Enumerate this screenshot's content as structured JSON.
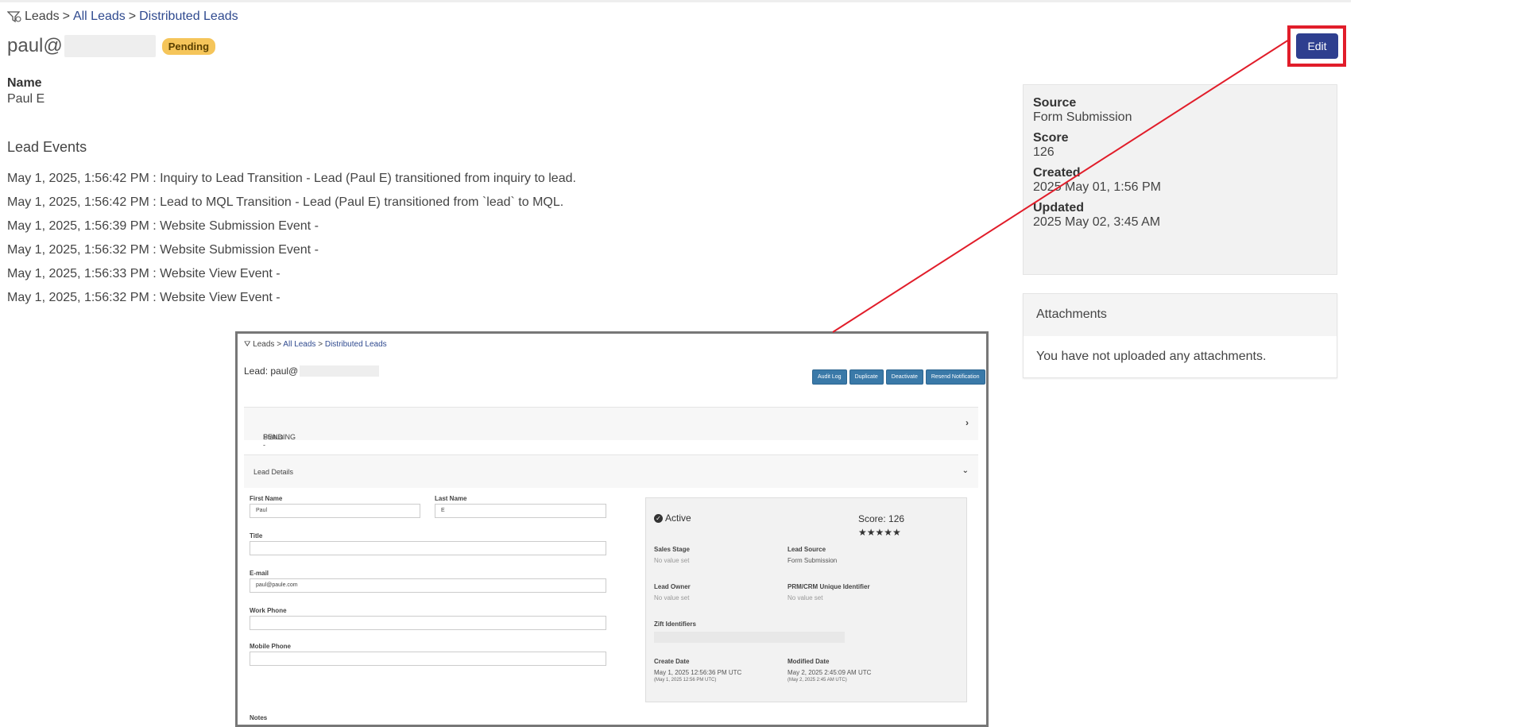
{
  "breadcrumb": {
    "root": "Leads",
    "sep1": ">",
    "all_leads": "All Leads",
    "sep2": ">",
    "distributed": "Distributed Leads"
  },
  "header": {
    "title_prefix": "paul@",
    "status_badge": "Pending",
    "edit_label": "Edit"
  },
  "name": {
    "label": "Name",
    "value": "Paul E"
  },
  "events": {
    "heading": "Lead Events",
    "items": [
      "May 1, 2025, 1:56:42 PM : Inquiry to Lead Transition - Lead (Paul E) transitioned from inquiry to lead.",
      "May 1, 2025, 1:56:42 PM : Lead to MQL Transition - Lead (Paul E) transitioned from `lead` to MQL.",
      "May 1, 2025, 1:56:39 PM : Website Submission Event -",
      "May 1, 2025, 1:56:32 PM : Website Submission Event -",
      "May 1, 2025, 1:56:33 PM : Website View Event -",
      "May 1, 2025, 1:56:32 PM : Website View Event -"
    ]
  },
  "side": {
    "source_label": "Source",
    "source_value": "Form Submission",
    "score_label": "Score",
    "score_value": "126",
    "created_label": "Created",
    "created_value": "2025 May 01, 1:56 PM",
    "updated_label": "Updated",
    "updated_value": "2025 May 02, 3:45 AM"
  },
  "attachments": {
    "heading": "Attachments",
    "empty_text": "You have not uploaded any attachments."
  },
  "colors": {
    "accent": "#2e3f8f",
    "highlight": "#e11d2a",
    "badge": "#f5c55a"
  },
  "inset": {
    "breadcrumb": {
      "root": "Leads",
      "sep1": ">",
      "all_leads": "All Leads",
      "sep2": ">",
      "distributed": "Distributed Leads"
    },
    "lead_prefix": "Lead: paul@",
    "buttons": [
      "Audit Log",
      "Duplicate",
      "Deactivate",
      "Resend Notification"
    ],
    "status_label": "Status - ",
    "status_value": "PENDING",
    "details_label": "Lead Details",
    "fields": {
      "first_name_label": "First Name",
      "first_name_value": "Paul",
      "last_name_label": "Last Name",
      "last_name_value": "E",
      "title_label": "Title",
      "email_label": "E-mail",
      "email_value": "paul@paule.com",
      "work_phone_label": "Work Phone",
      "mobile_phone_label": "Mobile Phone",
      "notes_label": "Notes"
    },
    "panel": {
      "active_label": "Active",
      "score_text": "Score: 126",
      "stars": "★★★★★",
      "sales_stage_label": "Sales Stage",
      "sales_stage_value": "No value set",
      "lead_source_label": "Lead Source",
      "lead_source_value": "Form Submission",
      "lead_owner_label": "Lead Owner",
      "lead_owner_value": "No value set",
      "prm_label": "PRM/CRM Unique Identifier",
      "prm_value": "No value set",
      "zift_label": "Zift Identifiers",
      "create_label": "Create Date",
      "create_value": "May 1, 2025 12:56:36 PM UTC",
      "create_sub": "(May 1, 2025 12:56 PM UTC)",
      "modified_label": "Modified Date",
      "modified_value": "May 2, 2025 2:45:09 AM UTC",
      "modified_sub": "(May 2, 2025 2:45 AM UTC)"
    }
  }
}
